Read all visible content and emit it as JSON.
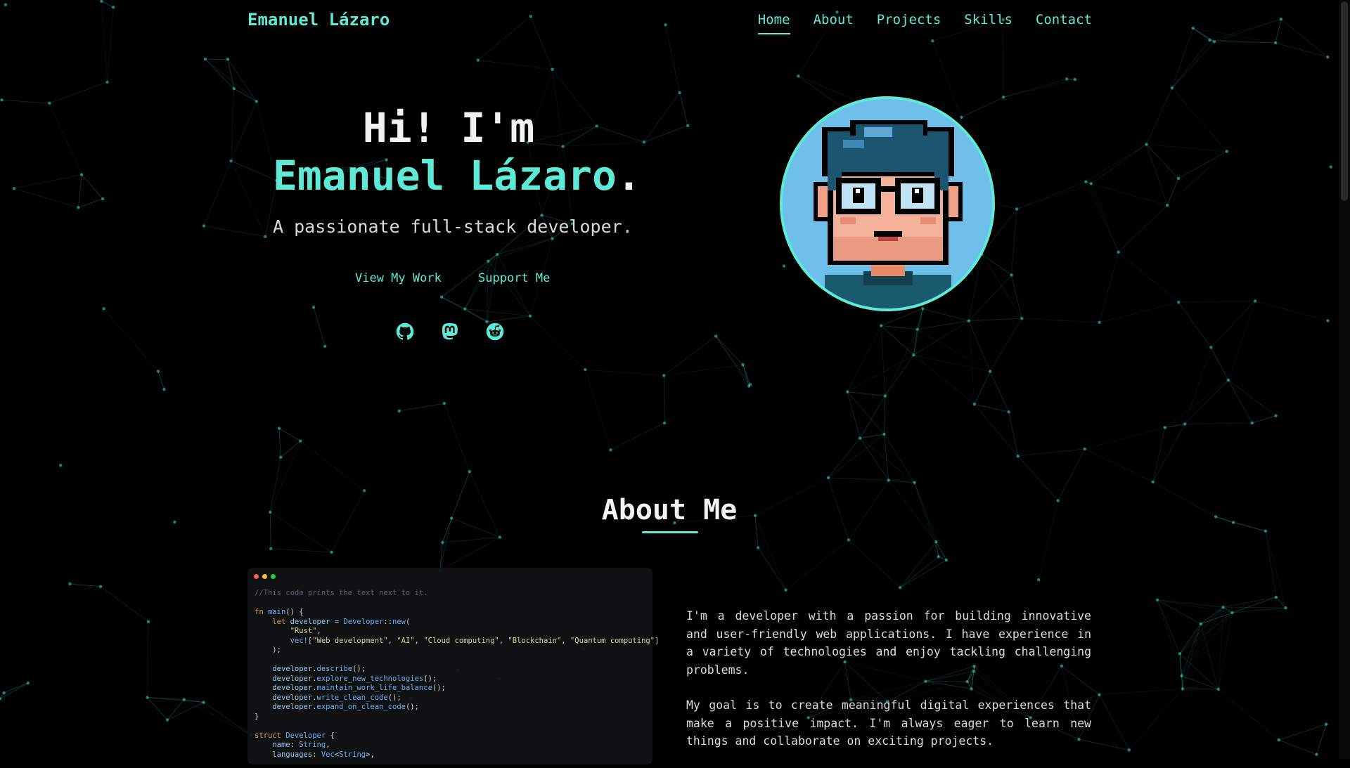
{
  "brand": "Emanuel Lázaro",
  "nav": [
    {
      "label": "Home",
      "active": true
    },
    {
      "label": "About"
    },
    {
      "label": "Projects"
    },
    {
      "label": "Skills"
    },
    {
      "label": "Contact"
    }
  ],
  "hero": {
    "greeting": "Hi! I'm",
    "name": "Emanuel Lázaro",
    "name_suffix": ".",
    "tagline": "A passionate full-stack developer.",
    "cta_primary": "View My Work",
    "cta_secondary": "Support Me",
    "social_icons": [
      "github-icon",
      "mastodon-icon",
      "reddit-icon"
    ]
  },
  "about": {
    "title": "About Me",
    "code_comment": "//This code prints the text next to it.",
    "paragraphs": [
      "I'm a developer with a passion for building innovative and user-friendly web applications. I have experience in a variety of technologies and enjoy tackling challenging problems.",
      "My goal is to create meaningful digital experiences that make a positive impact. I'm always eager to learn new things and collaborate on exciting projects."
    ]
  },
  "colors": {
    "accent": "#5eead4",
    "background": "#000000",
    "avatar_bg": "#6ec0ea"
  }
}
